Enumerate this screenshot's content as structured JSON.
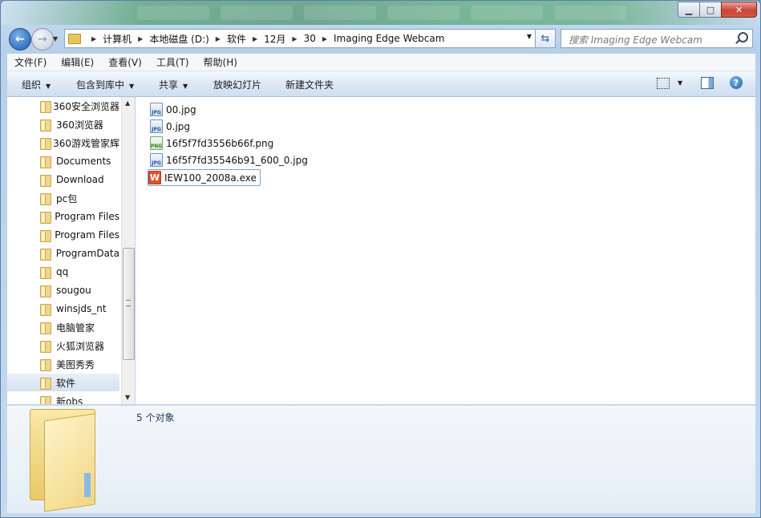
{
  "window": {
    "controls": {
      "minimize": "▁",
      "maximize": "□",
      "close": "✕"
    }
  },
  "nav": {
    "back_glyph": "←",
    "forward_glyph": "→",
    "breadcrumb": [
      "计算机",
      "本地磁盘 (D:)",
      "软件",
      "12月",
      "30",
      "Imaging Edge Webcam"
    ],
    "search_placeholder": "搜索 Imaging Edge Webcam"
  },
  "menu": [
    "文件(F)",
    "编辑(E)",
    "查看(V)",
    "工具(T)",
    "帮助(H)"
  ],
  "toolbar": {
    "organize": "组织",
    "include_in_library": "包含到库中",
    "share": "共享",
    "slideshow": "放映幻灯片",
    "new_folder": "新建文件夹",
    "help_glyph": "?"
  },
  "sidebar": {
    "items": [
      "360安全浏览器",
      "360浏览器",
      "360游戏管家辉",
      "Documents",
      "Download",
      "pc包",
      "Program Files",
      "Program Files",
      "ProgramData",
      "qq",
      "sougou",
      "winsjds_nt",
      "电脑管家",
      "火狐浏览器",
      "美图秀秀",
      "软件",
      "新obs"
    ],
    "selected_index": 15
  },
  "files": [
    {
      "name": "00.jpg",
      "type": "jpg",
      "icon": "JPG"
    },
    {
      "name": "0.jpg",
      "type": "jpg",
      "icon": "JPG"
    },
    {
      "name": "16f5f7fd3556b66f.png",
      "type": "png",
      "icon": "PNG"
    },
    {
      "name": "16f5f7fd35546b91_600_0.jpg",
      "type": "jpg",
      "icon": "JPG"
    },
    {
      "name": "IEW100_2008a.exe",
      "type": "exe",
      "icon": "W"
    }
  ],
  "selected_file_index": 4,
  "details": {
    "status": "5 个对象"
  }
}
